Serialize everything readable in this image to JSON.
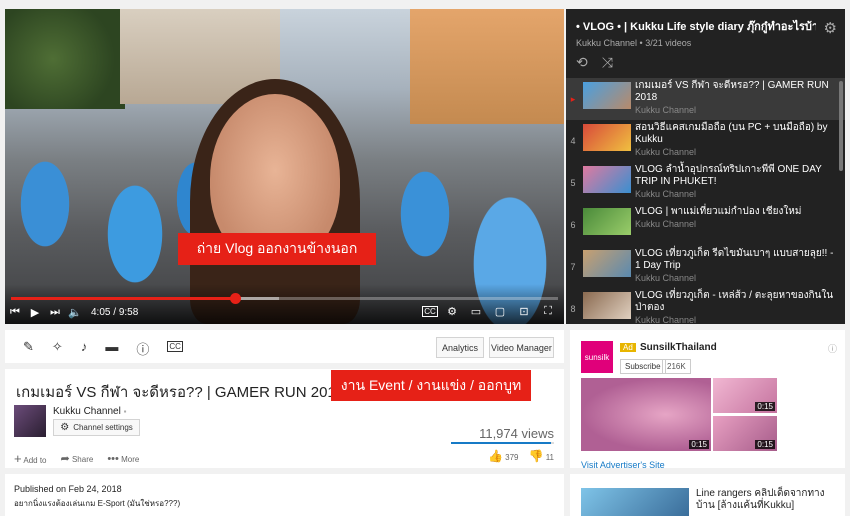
{
  "player": {
    "caption": "ถ่าย Vlog ออกงานข้างนอก",
    "time_current": "4:05",
    "time_separator": "/",
    "time_total": "9:58",
    "progress_fraction": 0.41
  },
  "playlist": {
    "title": "• VLOG • | Kukku Life style diary ภุ๊กกู๋ทำอะไรบ้างนะ?",
    "subtitle": "Kukku Channel • 3/21 videos",
    "items": [
      {
        "index": "▸",
        "title": "เกมเมอร์ VS กีฬา จะดีหรอ?? | GAMER RUN 2018",
        "channel": "Kukku Channel",
        "active": true
      },
      {
        "index": "4",
        "title": "สอนวิธีแคสเกมมือถือ (บน PC + บนมือถือ) by Kukku",
        "channel": "Kukku Channel"
      },
      {
        "index": "5",
        "title": "VLOG ลำน้ำอุปกรณ์ทริปเกาะพีพี ONE DAY TRIP IN PHUKET!",
        "channel": "Kukku Channel"
      },
      {
        "index": "6",
        "title": "VLOG | พาแม่เที่ยวแม่กำปอง เชียงใหม่",
        "channel": "Kukku Channel"
      },
      {
        "index": "7",
        "title": "VLOG เที่ยวภูเก็ต รีดไขมันเบาๆ แบบสายลุย!! - 1 Day Trip",
        "channel": "Kukku Channel"
      },
      {
        "index": "8",
        "title": "VLOG เที่ยวภูเก็ต - เหล่ส้ว / ตะลุยหาของกินในป่าตอง",
        "channel": "Kukku Channel"
      }
    ]
  },
  "toolbar": {
    "analytics_label": "Analytics",
    "video_manager_label": "Video Manager"
  },
  "video": {
    "title": "เกมเมอร์ VS กีฬา จะดีหรอ?? | GAMER RUN 2018",
    "event_banner": "งาน Event / งานแข่ง / ออกบูท",
    "channel_name": "Kukku Channel",
    "channel_settings_label": "Channel settings",
    "views": "11,974 views",
    "like_ratio": 0.97,
    "add_to_label": "Add to",
    "share_label": "Share",
    "more_label": "More",
    "likes": "379",
    "dislikes": "11"
  },
  "description": {
    "published": "Published on Feb 24, 2018",
    "text": "อยากนิ่งแรงต้องเล่นเกม E-Sport (มันใช่หรอ???)"
  },
  "ad": {
    "logo_text": "sunsilk",
    "badge": "Ad",
    "name": "SunsilkThailand",
    "info_icon": "ⓘ",
    "subscribe_label": "Subscribe",
    "subscriber_count": "216K",
    "main_duration": "0:15",
    "side1_duration": "0:15",
    "side2_duration": "0:15",
    "visit_label": "Visit Advertiser's Site"
  },
  "related": {
    "title": "Line rangers คลิปเด็ดจากทาง บ้าน [ล้างแค้นที่Kukku]"
  },
  "colors": {
    "accent_red": "#e62117",
    "link_blue": "#167ac6",
    "playlist_bg": "#222222"
  }
}
